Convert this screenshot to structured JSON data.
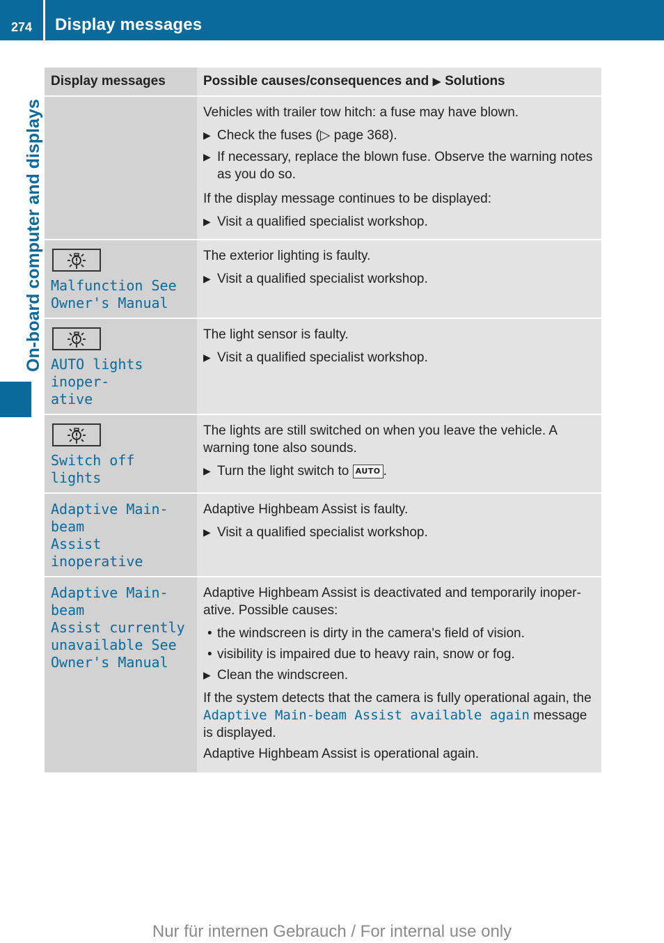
{
  "header": {
    "page_number": "274",
    "title": "Display messages"
  },
  "side_label": "On-board computer and displays",
  "table": {
    "columns": {
      "message": "Display messages",
      "solutions_prefix": "Possible causes/consequences and",
      "solutions_arrow": "▶",
      "solutions_suffix": "Solutions"
    },
    "rows": [
      {
        "icon": "",
        "message": "",
        "solution": {
          "para1": "Vehicles with trailer tow hitch: a fuse may have blown.",
          "step1_a": "Check the fuses (",
          "step1_ref": "▷",
          "step1_b": " page 368).",
          "step2": "If necessary, replace the blown fuse. Observe the warning notes as you do so.",
          "para2": "If the display message continues to be displayed:",
          "step3": "Visit a qualified specialist workshop."
        }
      },
      {
        "icon": "lamp-fault-icon",
        "message": "Malfunction See\nOwner's Manual",
        "solution": {
          "para1": "The exterior lighting is faulty.",
          "step1": "Visit a qualified specialist workshop."
        }
      },
      {
        "icon": "lamp-fault-icon",
        "message": "AUTO lights inoper‑\native",
        "solution": {
          "para1": "The light sensor is faulty.",
          "step1": "Visit a qualified specialist workshop."
        }
      },
      {
        "icon": "lamp-fault-icon",
        "message": "Switch off lights",
        "solution": {
          "para1": "The lights are still switched on when you leave the vehicle. A warning tone also sounds.",
          "step1": "Turn the light switch to",
          "badge": "AUTO",
          "step1_end": "."
        }
      },
      {
        "message": "Adaptive Main-beam\nAssist inoperative",
        "solution": {
          "para1": "Adaptive Highbeam Assist is faulty.",
          "step1": "Visit a qualified specialist workshop."
        }
      },
      {
        "message": "Adaptive Main-beam\nAssist currently\nunavailable See\nOwner's Manual",
        "solution": {
          "para1": "Adaptive Highbeam Assist is deactivated and temporarily inoper-ative. Possible causes:",
          "bullet1": "the windscreen is dirty in the camera's field of vision.",
          "bullet2": "visibility is impaired due to heavy rain, snow or fog.",
          "step1": "Clean the windscreen.",
          "para2_a": "If the system detects that the camera is fully operational again, the",
          "para2_msg": "Adaptive Main-beam Assist available again",
          "para2_b": "message is displayed.",
          "para3": "Adaptive Highbeam Assist is operational again."
        }
      }
    ]
  },
  "symbols": {
    "step_arrow": "▶",
    "bullet": "•"
  },
  "footer": "Nur für internen Gebrauch / For internal use only",
  "colors": {
    "brand_blue": "#0a6a9c",
    "header_col_bg": "#d2d2d2",
    "body_col_bg": "#e3e3e3"
  }
}
